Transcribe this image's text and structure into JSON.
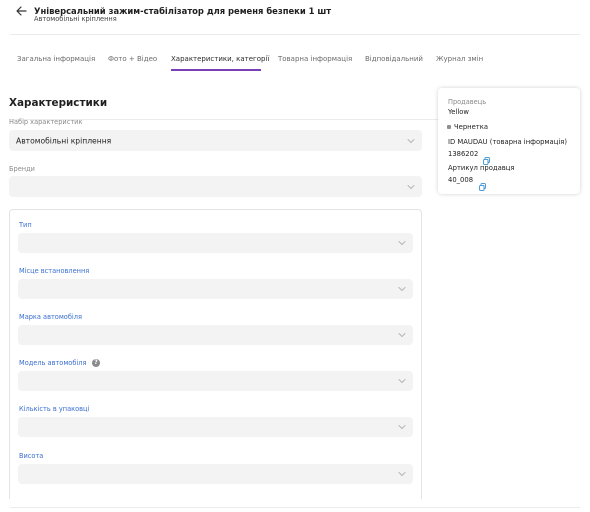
{
  "header": {
    "title": "Універсальний зажим-стабілізатор для ременя безпеки 1 шт",
    "subtitle": "Автомобільні кріплення",
    "back_icon": "arrow-left-icon"
  },
  "tabs": [
    {
      "label": "Загальна інформація",
      "active": false
    },
    {
      "label": "Фото + Відео",
      "active": false
    },
    {
      "label": "Характеристики, категорії",
      "active": true
    },
    {
      "label": "Товарна інформація",
      "active": false
    },
    {
      "label": "Відповідальний",
      "active": false
    },
    {
      "label": "Журнал змін",
      "active": false
    }
  ],
  "section": {
    "title": "Характеристики",
    "set_label": "Набір характеристик",
    "set_value": "Автомобільні кріплення",
    "brand_label": "Бренди",
    "brand_value": ""
  },
  "fields": [
    {
      "label": "Тип",
      "value": ""
    },
    {
      "label": "Місце встановлення",
      "value": ""
    },
    {
      "label": "Марка автомобіля",
      "value": ""
    },
    {
      "label": "Модель автомобіля",
      "value": "",
      "help": true
    },
    {
      "label": "Кількість в упаковці",
      "value": ""
    },
    {
      "label": "Висота",
      "value": ""
    }
  ],
  "card": {
    "seller_label": "Продавець",
    "seller_value": "Yellow",
    "status": "Чернетка",
    "id_label": "ID MAUDAU (товарна інформація)",
    "id_value": "1386202",
    "sku_label": "Артикул продавця",
    "sku_value": "40_008"
  },
  "colors": {
    "accent": "#7b3fb5",
    "field_label_blue": "#3a6fd0",
    "copy_icon": "#3a8fd0"
  }
}
